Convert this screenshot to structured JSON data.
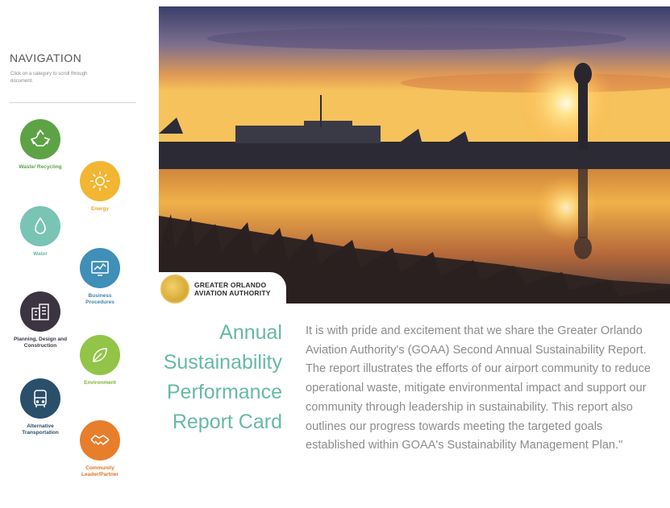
{
  "navigation": {
    "title": "NAVIGATION",
    "subtitle": "Click on a category to scroll through document."
  },
  "categories": [
    {
      "label": "Waste/ Recycling",
      "icon": "recycle-icon",
      "color": "#5da346",
      "label_color": "#5da346"
    },
    {
      "label": "Energy",
      "icon": "sun-icon",
      "color": "#f3b632",
      "label_color": "#e8a428"
    },
    {
      "label": "Water",
      "icon": "water-drop-icon",
      "color": "#79c4b5",
      "label_color": "#6ab7a8"
    },
    {
      "label": "Business Procedures",
      "icon": "monitor-chart-icon",
      "color": "#3f8fb8",
      "label_color": "#3b82ab"
    },
    {
      "label": "Planning, Design and Construction",
      "icon": "buildings-icon",
      "color": "#3b3542",
      "label_color": "#3b3542"
    },
    {
      "label": "Environment",
      "icon": "leaf-icon",
      "color": "#92c447",
      "label_color": "#7fb237"
    },
    {
      "label": "Alternative Transportation",
      "icon": "bus-icon",
      "color": "#2a4f6b",
      "label_color": "#2a4f6b"
    },
    {
      "label": "Community Leader/Partner",
      "icon": "handshake-icon",
      "color": "#e77e2c",
      "label_color": "#e07428"
    }
  ],
  "logo": {
    "line1": "GREATER ORLANDO",
    "line2": "AVIATION AUTHORITY"
  },
  "report_title": [
    "Annual",
    "Sustainability",
    "Performance",
    "Report Card"
  ],
  "intro_text": "It is with pride and excitement that we share the Greater Orlando Aviation Authority's (GOAA) Second Annual Sustainability Report. The report illustrates the efforts of our airport community to reduce operational waste, mitigate environmental impact and support our community through leadership in sustainability. This report also outlines our progress towards meeting the targeted goals established within GOAA's Sustainability Management Plan.\"",
  "colors": {
    "title_teal": "#67b9a6",
    "body_gray": "#8c8c8c"
  }
}
